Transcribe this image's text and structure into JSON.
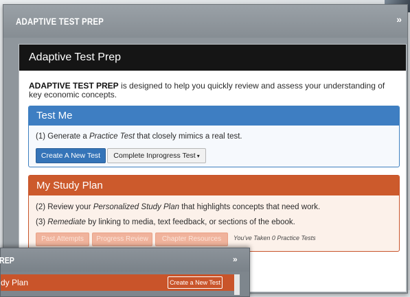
{
  "back_window": {
    "title": "ADAPTIVE TEST PREP",
    "expand_glyph": "»"
  },
  "panel": {
    "title": "Adaptive Test Prep",
    "intro_bold": "ADAPTIVE TEST PREP",
    "intro_rest": " is designed to help you quickly review and assess your understanding of key economic concepts."
  },
  "test_me": {
    "title": "Test Me",
    "line_prefix": "(1) Generate a ",
    "line_em": "Practice Test",
    "line_suffix": " that closely mimics a real test.",
    "create_button": "Create A New Test",
    "complete_button": "Complete Inprogress Test",
    "caret": "▾",
    "accent": "#3e7ec2"
  },
  "study_plan": {
    "title": "My Study Plan",
    "line2_prefix": "(2) Review your ",
    "line2_em": "Personalized Study Plan",
    "line2_suffix": " that highlights concepts that need work.",
    "line3_prefix": "(3) ",
    "line3_em": "Remediate",
    "line3_suffix": " by linking to media, text feedback, or sections of the ebook.",
    "btn_past": "Past Attempts",
    "btn_progress": "Progress Review",
    "btn_resources": "Chapter Resources",
    "taken_text": "You've Taken 0 Practice Tests",
    "accent": "#cc5a2c"
  },
  "front_window": {
    "title": "REP",
    "expand_glyph": "»",
    "strip_text": "dy Plan",
    "strip_button": "Create a New Test"
  }
}
